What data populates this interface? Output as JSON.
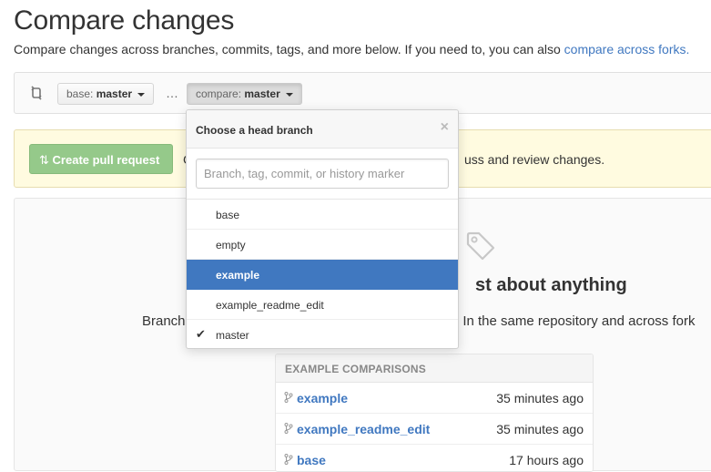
{
  "header": {
    "title": "Compare changes",
    "subtitle_text": "Compare changes across branches, commits, tags, and more below. If you need to, you can also ",
    "subtitle_link": "compare across forks."
  },
  "range": {
    "base_label": "base:",
    "base_value": "master",
    "separator": "…",
    "compare_label": "compare:",
    "compare_value": "master"
  },
  "flash": {
    "button_label": "Create pull request",
    "text_prefix": "C",
    "text_suffix": "uss and review changes."
  },
  "blankslate": {
    "heading": "st about anything",
    "text_left": "Branch",
    "text_right": ". In the same repository and across fork",
    "examples_title": "EXAMPLE COMPARISONS",
    "examples": [
      {
        "name": "example",
        "time": "35 minutes ago"
      },
      {
        "name": "example_readme_edit",
        "time": "35 minutes ago"
      },
      {
        "name": "base",
        "time": "17 hours ago"
      }
    ]
  },
  "dropdown": {
    "title": "Choose a head branch",
    "close": "×",
    "filter_placeholder": "Branch, tag, commit, or history marker",
    "items": [
      {
        "label": "base",
        "selected": false,
        "checked": false
      },
      {
        "label": "empty",
        "selected": false,
        "checked": false
      },
      {
        "label": "example",
        "selected": true,
        "checked": false
      },
      {
        "label": "example_readme_edit",
        "selected": false,
        "checked": false
      },
      {
        "label": "master",
        "selected": false,
        "checked": true
      }
    ],
    "check_glyph": "✔"
  },
  "colors": {
    "link": "#4078c0",
    "selected_bg": "#4078c0",
    "create_button": "#95c98a",
    "flash_bg": "#fffbe0"
  },
  "icons": [
    "compare-arrows-icon",
    "caret-down-icon",
    "close-icon",
    "tag-icon",
    "branch-icon",
    "checkmark-icon"
  ]
}
